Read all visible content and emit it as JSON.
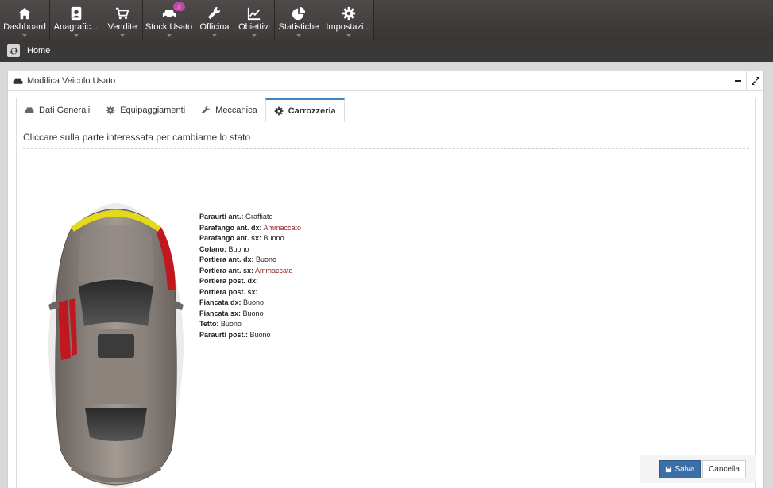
{
  "nav": {
    "items": [
      {
        "label": "Dashboard",
        "icon": "home-icon"
      },
      {
        "label": "Anagrafic...",
        "icon": "contacts-icon"
      },
      {
        "label": "Vendite",
        "icon": "cart-icon"
      },
      {
        "label": "Stock Usato",
        "icon": "car-icon",
        "badge": "☆"
      },
      {
        "label": "Officina",
        "icon": "wrench-icon"
      },
      {
        "label": "Obiettivi",
        "icon": "chart-line-icon"
      },
      {
        "label": "Statistiche",
        "icon": "pie-chart-icon"
      },
      {
        "label": "Impostazi...",
        "icon": "gear-icon"
      }
    ]
  },
  "breadcrumb": {
    "home": "Home"
  },
  "panel": {
    "title": "Modifica Veicolo Usato"
  },
  "tabs": [
    {
      "label": "Dati Generali",
      "icon": "car-icon"
    },
    {
      "label": "Equipaggiamenti",
      "icon": "gear-icon"
    },
    {
      "label": "Meccanica",
      "icon": "wrench-icon"
    },
    {
      "label": "Carrozzeria",
      "icon": "gear-icon",
      "active": true
    }
  ],
  "instruction": "Cliccare sulla parte interessata per cambiarne lo stato",
  "status": [
    {
      "key": "Paraurti ant.:",
      "value": "Graffiato"
    },
    {
      "key": "Parafango ant. dx:",
      "value": "Ammaccato"
    },
    {
      "key": "Parafango ant. sx:",
      "value": "Buono"
    },
    {
      "key": "Cofano:",
      "value": "Buono"
    },
    {
      "key": "Portiera ant. dx:",
      "value": "Buono"
    },
    {
      "key": "Portiera ant. sx:",
      "value": "Ammaccato"
    },
    {
      "key": "Portiera post. dx:",
      "value": ""
    },
    {
      "key": "Portiera post. sx:",
      "value": ""
    },
    {
      "key": "Fiancata dx:",
      "value": "Buono"
    },
    {
      "key": "Fiancata sx:",
      "value": "Buono"
    },
    {
      "key": "Tetto:",
      "value": "Buono"
    },
    {
      "key": "Paraurti post.:",
      "value": "Buono"
    }
  ],
  "buttons": {
    "save": "Salva",
    "cancel": "Cancella"
  },
  "colors": {
    "scratched": "#e6d81a",
    "dented": "#c0181e",
    "accent": "#3b6fa8"
  }
}
